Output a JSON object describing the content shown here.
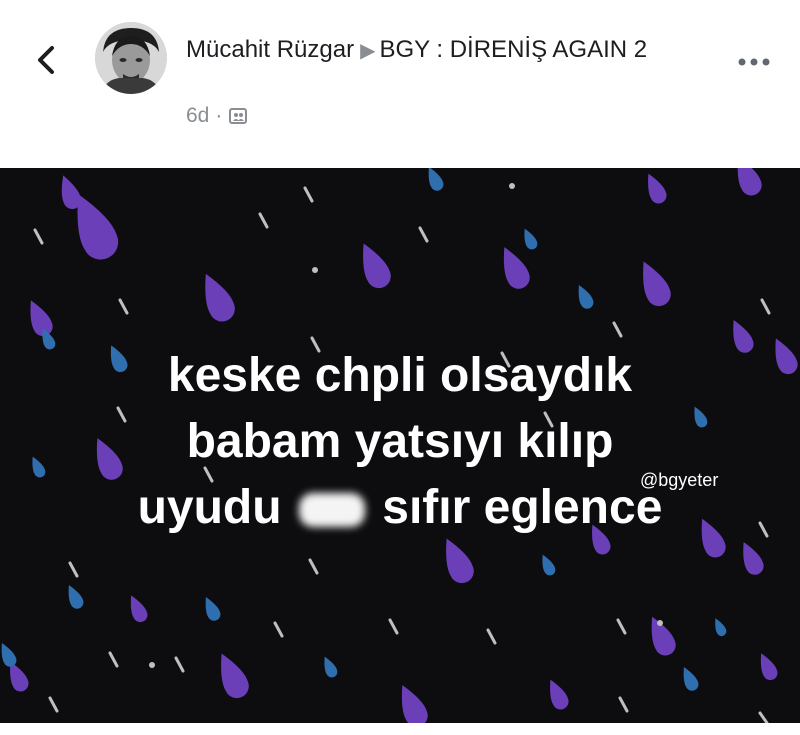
{
  "post": {
    "author": "Mücahit Rüzgar",
    "group": "BGY : DİRENİŞ AGAIN 2",
    "time": "6d",
    "separator": "·"
  },
  "icons": {
    "back": "chevron-left-icon",
    "privacy": "group-audience-icon",
    "more": "more-options-icon",
    "arrow": "right-triangle-icon"
  },
  "image": {
    "line1": "keske chpli olsaydık",
    "line2": "babam yatsıyı kılıp",
    "line3_a": "uyudu",
    "line3_b": "sıfır eglence",
    "watermark": "@bgyeter",
    "colors": {
      "background": "#0d0d10",
      "drop_purple": "#6a3fb8",
      "drop_blue": "#2f6fb0",
      "streak": "#bfbfbf"
    }
  }
}
